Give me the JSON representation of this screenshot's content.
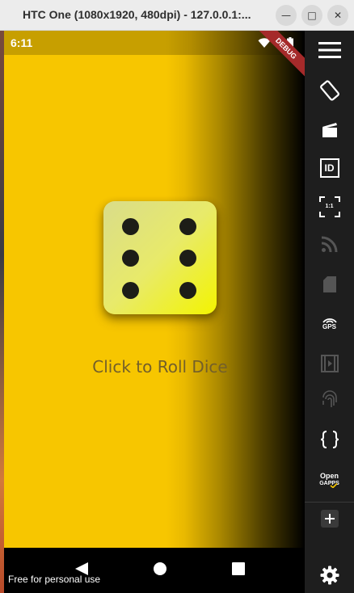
{
  "window": {
    "title": "HTC One (1080x1920, 480dpi) - 127.0.0.1:...",
    "minimize_glyph": "—",
    "maximize_glyph": "□",
    "close_glyph": "✕"
  },
  "statusbar": {
    "time": "6:11",
    "icons": [
      "wifi-icon",
      "battery-icon"
    ]
  },
  "debug_banner": "DEBUG",
  "app": {
    "dice_face": 6,
    "roll_label": "Click to Roll Dice",
    "colors": {
      "background": "#f7c600",
      "dice": "#e8ea6a",
      "pip": "#1d1d17",
      "label": "#735f2a"
    }
  },
  "navbar": {
    "buttons": [
      "back-icon",
      "home-icon",
      "recents-icon"
    ]
  },
  "watermark": "Free for personal use",
  "toolbar": {
    "id_label": "ID",
    "zoom_label": "1:1",
    "gps_label": "GPS",
    "opengapps_top": "Open",
    "opengapps_bottom": "GAPPS",
    "items": [
      "menu-icon",
      "rotate-icon",
      "screencast-icon",
      "identifier-icon",
      "pixel-perfect-icon",
      "rss-icon",
      "sim-icon",
      "gps-icon",
      "media-icon",
      "fingerprint-icon",
      "code-icon",
      "opengapps-icon",
      "plus-icon",
      "settings-icon"
    ]
  }
}
